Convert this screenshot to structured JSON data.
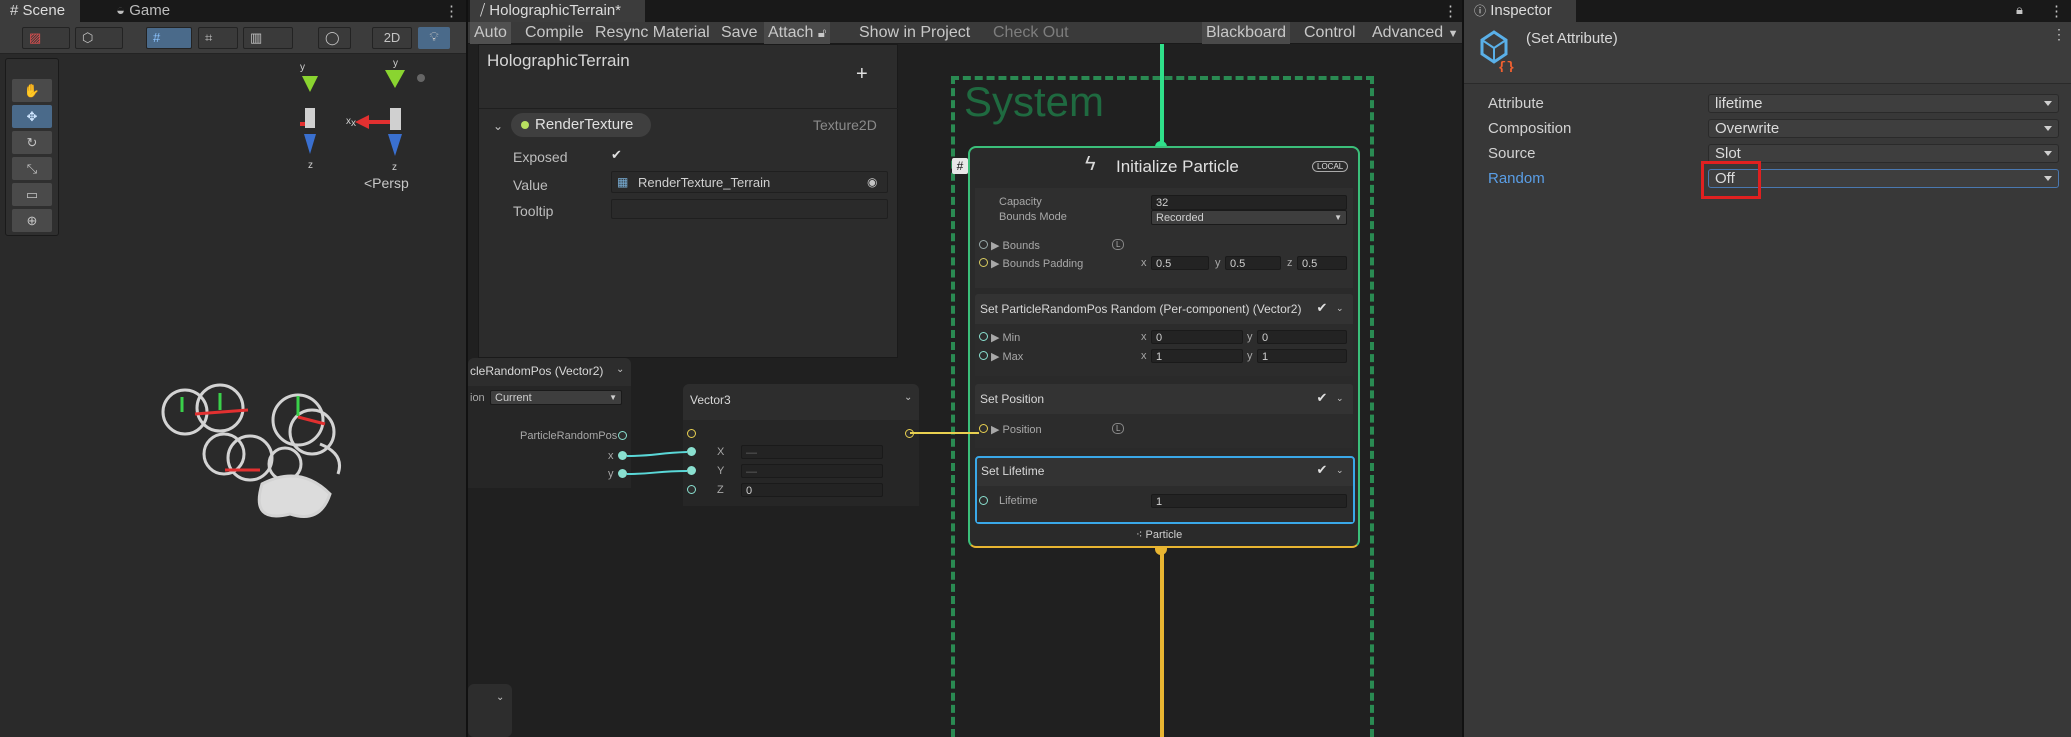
{
  "scene_panel": {
    "tab_scene": "Scene",
    "tab_game": "Game",
    "btn_2d": "2D",
    "persp_label": "<Persp",
    "gizmo_y": "y",
    "gizmo_x": "x",
    "gizmo_z": "z"
  },
  "vfx_panel": {
    "tab_title": "HolographicTerrain*",
    "toolbar": {
      "auto": "Auto",
      "compile": "Compile",
      "resync": "Resync Material",
      "save": "Save",
      "attach": "Attach",
      "show_in_project": "Show in Project",
      "check_out": "Check Out",
      "blackboard": "Blackboard",
      "control": "Control",
      "advanced": "Advanced"
    },
    "blackboard": {
      "title": "HolographicTerrain",
      "add": "+",
      "prop_name": "RenderTexture",
      "prop_type": "Texture2D",
      "exposed_label": "Exposed",
      "exposed_check": "✔",
      "value_label": "Value",
      "value": "RenderTexture_Terrain",
      "tooltip_label": "Tooltip"
    },
    "system_label": "System",
    "hash": "#",
    "init_node": {
      "title": "Initialize Particle",
      "local_badge": "LOCAL",
      "capacity_label": "Capacity",
      "capacity": "32",
      "bounds_mode_label": "Bounds Mode",
      "bounds_mode": "Recorded",
      "bounds_label": "Bounds",
      "bounds_padding_label": "Bounds Padding",
      "bp_x_lbl": "x",
      "bp_x": "0.5",
      "bp_y_lbl": "y",
      "bp_y": "0.5",
      "bp_z_lbl": "z",
      "bp_z": "0.5",
      "l_badge": "L",
      "l_badge2": "L"
    },
    "block_random": {
      "title": "Set ParticleRandomPos Random (Per-component) (Vector2)",
      "min_label": "Min",
      "min_x_lbl": "x",
      "min_x": "0",
      "min_y_lbl": "y",
      "min_y": "0",
      "max_label": "Max",
      "max_x_lbl": "x",
      "max_x": "1",
      "max_y_lbl": "y",
      "max_y": "1",
      "check": "✔"
    },
    "block_position": {
      "title": "Set Position",
      "position_label": "Position",
      "check": "✔"
    },
    "block_lifetime": {
      "title": "Set Lifetime",
      "lifetime_label": "Lifetime",
      "lifetime": "1",
      "check": "✔"
    },
    "particle_label": "Particle",
    "get_node": {
      "title": "cleRandomPos (Vector2)",
      "ion_label": "ion",
      "ion_value": "Current",
      "out_label": "ParticleRandomPos",
      "x_label": "x",
      "y_label": "y"
    },
    "vector3_node": {
      "title": "Vector3",
      "x_label": "X",
      "x_value": "—",
      "y_label": "Y",
      "y_value": "—",
      "z_label": "Z",
      "z_value": "0"
    }
  },
  "inspector": {
    "tab": "Inspector",
    "header_title": "(Set Attribute)",
    "rows": [
      {
        "label": "Attribute",
        "value": "lifetime"
      },
      {
        "label": "Composition",
        "value": "Overwrite"
      },
      {
        "label": "Source",
        "value": "Slot"
      },
      {
        "label": "Random",
        "value": "Off"
      }
    ],
    "highlight_color": "#e02020",
    "accent_label_color": "#5a9ee6"
  },
  "colors": {
    "system_border": "#2a8a52",
    "init_border": "#3bbf7a",
    "flow_green": "#2fe08a",
    "flow_yellow": "#e8b531",
    "selected_block": "#3aa8e8"
  }
}
